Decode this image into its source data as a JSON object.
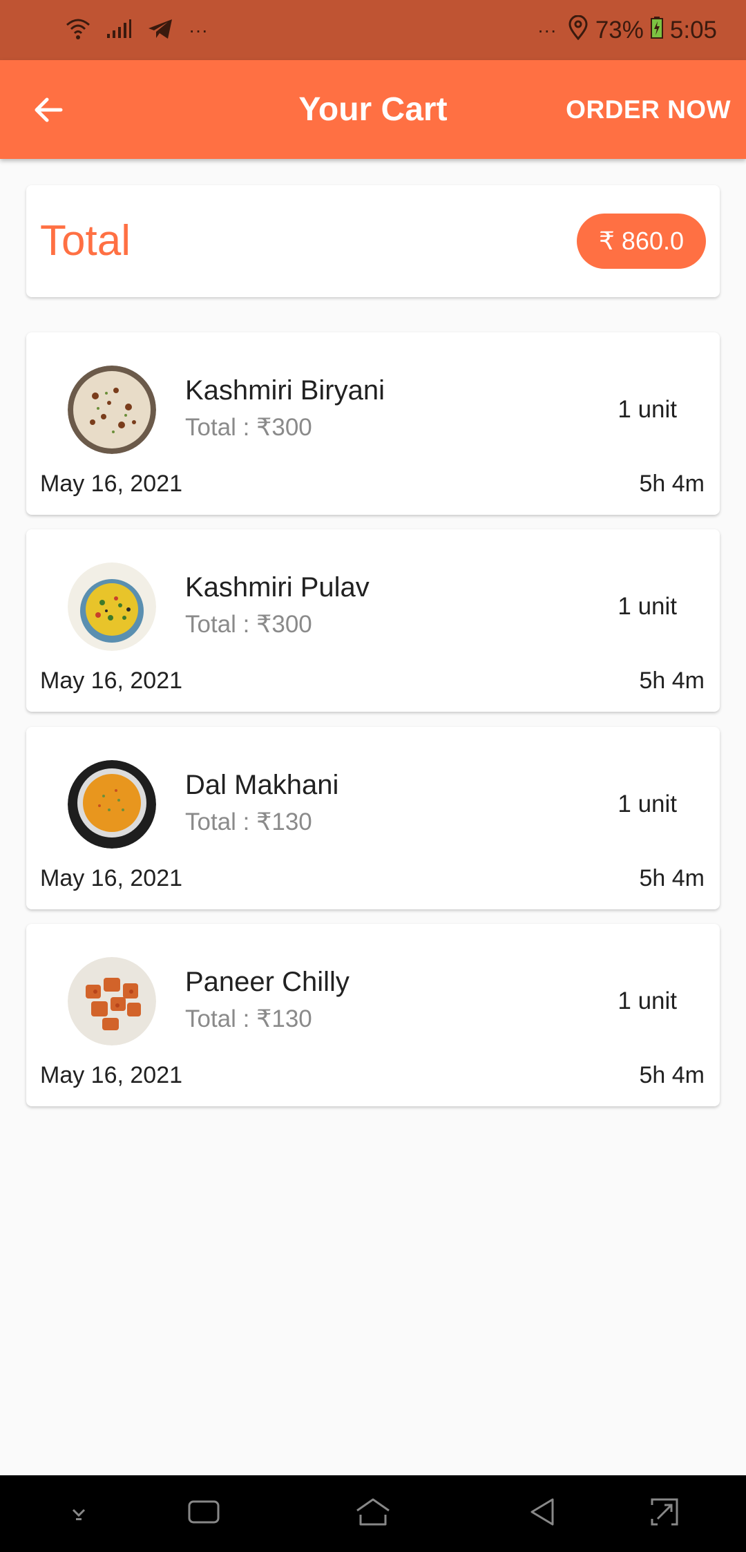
{
  "status_bar": {
    "left_dots": "···",
    "right_dots": "···",
    "battery_percent": "73%",
    "time": "5:05",
    "icons": [
      "wifi-icon",
      "signal-icon",
      "telegram-icon",
      "location-icon",
      "battery-charging-icon"
    ]
  },
  "app_bar": {
    "title": "Your Cart",
    "action_label": "ORDER NOW",
    "back_icon": "arrow-left-icon"
  },
  "total": {
    "label": "Total",
    "amount": "₹ 860.0"
  },
  "items": [
    {
      "name": "Kashmiri Biryani",
      "total": "Total : ₹300",
      "qty": "1 unit",
      "date": "May 16, 2021",
      "time": "5h 4m"
    },
    {
      "name": "Kashmiri Pulav",
      "total": "Total : ₹300",
      "qty": "1 unit",
      "date": "May 16, 2021",
      "time": "5h 4m"
    },
    {
      "name": "Dal Makhani",
      "total": "Total : ₹130",
      "qty": "1 unit",
      "date": "May 16, 2021",
      "time": "5h 4m"
    },
    {
      "name": "Paneer Chilly",
      "total": "Total : ₹130",
      "qty": "1 unit",
      "date": "May 16, 2021",
      "time": "5h 4m"
    }
  ],
  "nav_bar": {
    "icons": [
      "hide-keyboard-icon",
      "recent-apps-icon",
      "home-icon",
      "back-icon",
      "rotate-icon"
    ]
  },
  "colors": {
    "accent": "#ff7043",
    "status_bar": "#bf5433",
    "background": "#fafafa"
  }
}
